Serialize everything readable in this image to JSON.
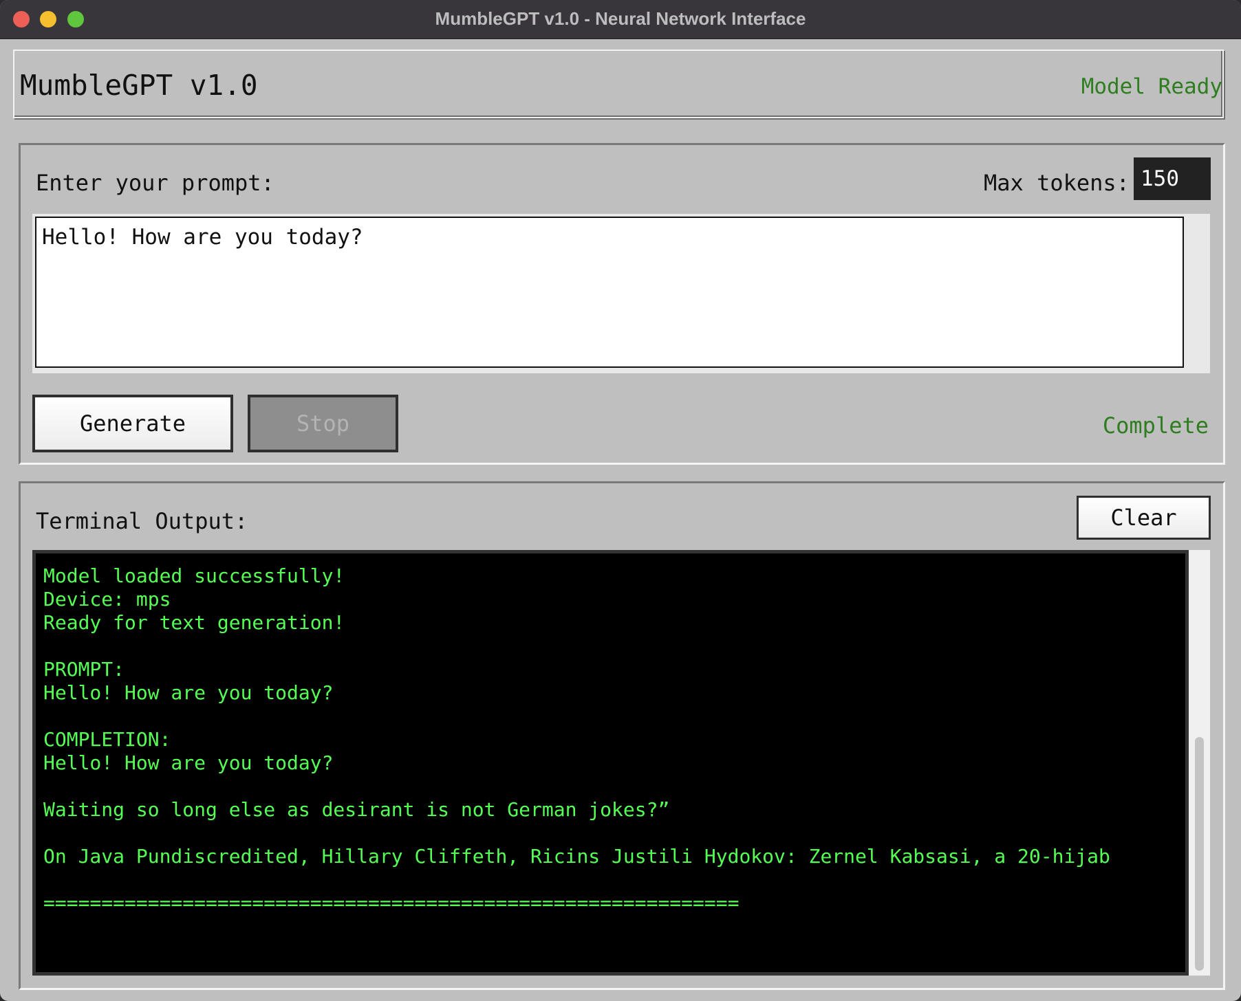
{
  "window": {
    "title": "MumbleGPT v1.0 - Neural Network Interface"
  },
  "header": {
    "app_title": "MumbleGPT v1.0",
    "model_status": "Model Ready",
    "status_color": "#2e7d1f"
  },
  "prompt": {
    "label": "Enter your prompt:",
    "max_tokens_label": "Max tokens:",
    "max_tokens_value": "150",
    "text": "Hello! How are you today?"
  },
  "buttons": {
    "generate_label": "Generate",
    "stop_label": "Stop",
    "stop_disabled": true,
    "clear_label": "Clear"
  },
  "generation_status": "Complete",
  "output": {
    "label": "Terminal Output:",
    "text_color": "#55ff55",
    "lines": [
      "Model loaded successfully!",
      "Device: mps",
      "Ready for text generation!",
      "",
      "PROMPT:",
      "Hello! How are you today?",
      "",
      "COMPLETION:",
      "Hello! How are you today?",
      "",
      "Waiting so long else as desirant is not German jokes?”",
      "",
      "On Java Pundiscredited, Hillary Cliffeth, Ricins Justili Hydokov: Zernel Kabsasi, a 20-hijab",
      "",
      "============================================================"
    ]
  }
}
